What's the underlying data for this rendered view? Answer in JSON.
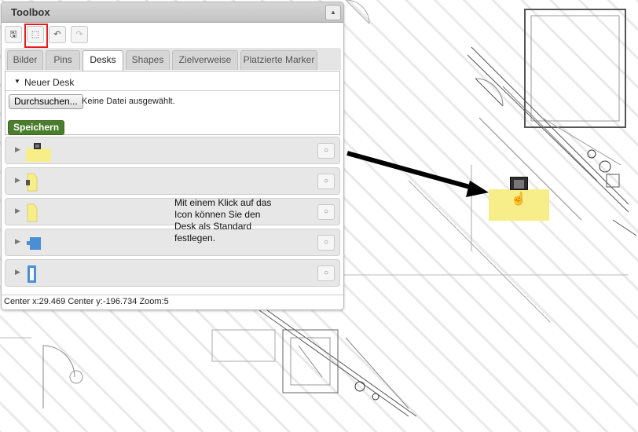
{
  "toolbox": {
    "title": "Toolbox",
    "collapse_icon": "chevron-up-icon",
    "tools": [
      {
        "icon": "save-icon",
        "glyph": "🖫"
      },
      {
        "icon": "move-icon",
        "glyph": "⬚"
      },
      {
        "icon": "undo-icon",
        "glyph": "↶"
      },
      {
        "icon": "redo-icon",
        "glyph": "↷"
      }
    ],
    "tabs": [
      "Bilder",
      "Pins",
      "Desks",
      "Shapes",
      "Zielverweise",
      "Platzierte Marker"
    ],
    "active_tab": "Desks",
    "form": {
      "section_label": "Neuer Desk",
      "browse_label": "Durchsuchen...",
      "file_status": "Keine Datei ausgewählt.",
      "save_label": "Speichern"
    },
    "desks": [
      {
        "icon": "desk-yellow-icon"
      },
      {
        "icon": "desk-yellow-rotated-icon"
      },
      {
        "icon": "desk-yellow-corner-icon"
      },
      {
        "icon": "desk-blue-icon"
      },
      {
        "icon": "desk-blue-vertical-icon"
      }
    ],
    "status": "Center x:29.469 Center y:-196.734 Zoom:5"
  },
  "annotation": {
    "text": "Mit einem Klick auf das Icon können Sie den Desk als Standard festlegen."
  },
  "colors": {
    "save_green": "#4a7d2c",
    "desk_yellow": "#f7ee8a",
    "desk_blue": "#4a8fd4",
    "highlight_red": "#e81c1c"
  }
}
